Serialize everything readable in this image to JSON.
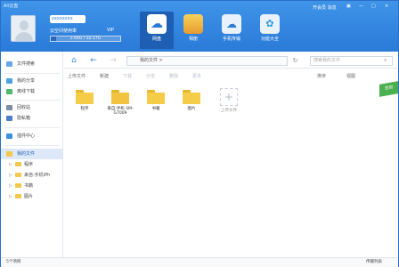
{
  "header": {
    "app_name": "Ali云盘",
    "username": "xxxxxxxx",
    "level_text": "云空间使用率",
    "vip_label": "VIP",
    "quota_text": "2.64G / 32.17G",
    "quota_fraction": 0.08,
    "account_text": "开会员  消息",
    "window_controls": [
      "▣",
      "—",
      "□",
      "✕"
    ]
  },
  "nav": {
    "tabs": [
      {
        "label": "网盘",
        "icon": "cloud-icon"
      },
      {
        "label": "相册",
        "icon": "photo-icon"
      },
      {
        "label": "手机传输",
        "icon": "phone-transfer-icon"
      },
      {
        "label": "功能大全",
        "icon": "apps-icon"
      }
    ]
  },
  "toolbar": {
    "path_text": "我的文件  >",
    "search_placeholder": "搜索我的文件"
  },
  "actions": {
    "upload": "上传文件",
    "new": "新建",
    "download": "下载",
    "share": "分享",
    "delete": "删除",
    "more": "更多",
    "sort": "排序",
    "view": "视图",
    "badge": "签到"
  },
  "sidebar": {
    "items": [
      {
        "label": "文件搜索"
      },
      {
        "label": "我的分享"
      },
      {
        "label": "离线下载"
      },
      {
        "label": "回收站"
      },
      {
        "label": "隐私箱"
      },
      {
        "label": "插件中心"
      },
      {
        "label": "我的文件"
      }
    ],
    "tree": [
      {
        "label": "程序"
      },
      {
        "label": "来自:手机iPh"
      },
      {
        "label": "书籍"
      },
      {
        "label": "图片"
      }
    ]
  },
  "files": [
    {
      "name": "程序"
    },
    {
      "name": "来自:手机 SM-G7009"
    },
    {
      "name": "书籍"
    },
    {
      "name": "图片"
    },
    {
      "name": "上传文件"
    }
  ],
  "status": {
    "left": "5个项目",
    "right": "传输列表"
  }
}
